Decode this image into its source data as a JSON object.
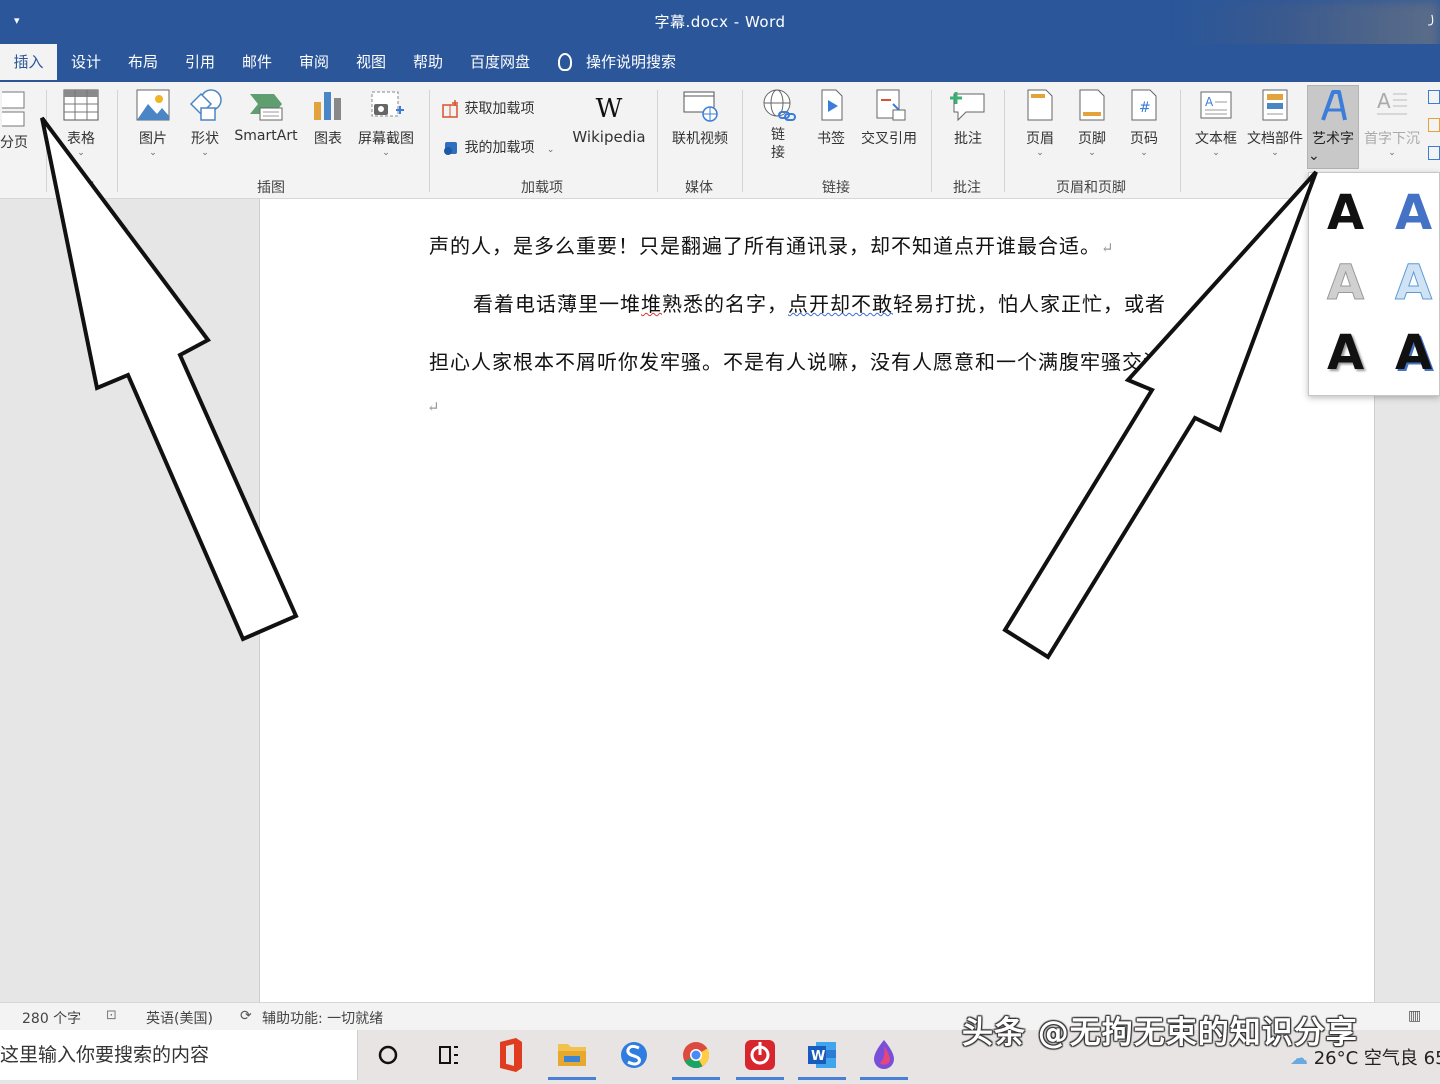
{
  "titlebar": {
    "qa_glyph": "▾",
    "title": "字幕.docx  -  Word",
    "edge_glyph": "꠸"
  },
  "tabs": [
    {
      "label": "插入",
      "active": true
    },
    {
      "label": "设计"
    },
    {
      "label": "布局"
    },
    {
      "label": "引用"
    },
    {
      "label": "邮件"
    },
    {
      "label": "审阅"
    },
    {
      "label": "视图"
    },
    {
      "label": "帮助"
    },
    {
      "label": "百度网盘"
    }
  ],
  "tell_me": "操作说明搜索",
  "ribbon": {
    "fenye": "分页",
    "table": "表格",
    "picture": "图片",
    "shapes": "形状",
    "smartart": "SmartArt",
    "chart": "图表",
    "screenshot": "屏幕截图",
    "get_addins": "获取加载项",
    "my_addins": "我的加载项",
    "wikipedia": "Wikipedia",
    "wiki_glyph": "W",
    "online_video": "联机视频",
    "link_1": "链",
    "link_2": "接",
    "bookmark": "书签",
    "crossref": "交叉引用",
    "comment": "批注",
    "header": "页眉",
    "footer": "页脚",
    "page_number": "页码",
    "textbox": "文本框",
    "quickparts": "文档部件",
    "wordart": "艺术字",
    "dropcap": "首字下沉",
    "groups": {
      "table": "表格",
      "illustrations": "插图",
      "addins": "加载项",
      "media": "媒体",
      "links": "链接",
      "comments": "批注",
      "header_footer": "页眉和页脚"
    }
  },
  "document": {
    "line1": "声的人，是多么重要！只是翻遍了所有通讯录，却不知道点开谁最合适。",
    "line2_a": "看着电话薄里一堆",
    "line2_b": "堆",
    "line2_c": "熟悉的名字，",
    "line2_d": "点开却不敢",
    "line2_e": "轻易打扰，怕人家正忙，或者",
    "line3": "担心人家根本不屑听你发牢骚。不是有人说嘛，没有人愿意和一个满腹牢骚交流。。",
    "para_mark": "↵"
  },
  "wordart_gallery": {
    "glyph": "A"
  },
  "status": {
    "words": "280 个字",
    "language": "英语(美国)",
    "accessibility": "辅助功能: 一切就绪"
  },
  "taskbar": {
    "search_placeholder": "这里输入你要搜索的内容",
    "weather": "26°C  空气良 65"
  },
  "watermark": "头条 @无拘无束的知识分享",
  "colors": {
    "accent": "#2b579a",
    "ribbon_bg": "#f3f3f3"
  }
}
